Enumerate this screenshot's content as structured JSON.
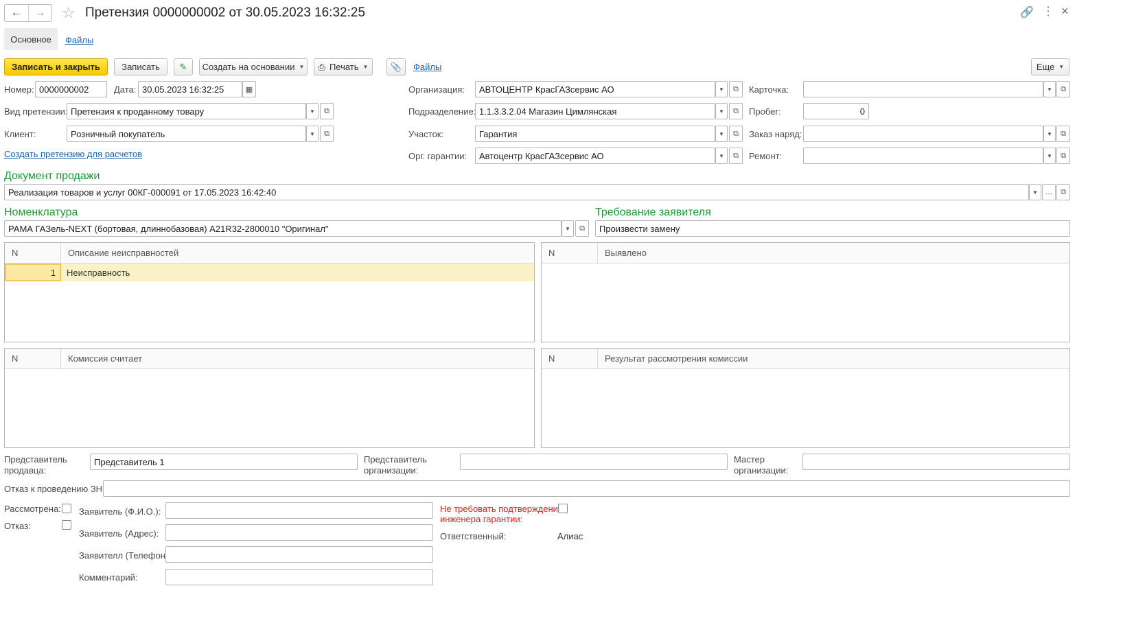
{
  "window": {
    "title": "Претензия 0000000002 от 30.05.2023 16:32:25",
    "back_icon": "arrow-left-icon",
    "forward_icon": "arrow-right-icon"
  },
  "tabs": {
    "main": "Основное",
    "files": "Файлы"
  },
  "toolbar": {
    "save_close": "Записать и закрыть",
    "save": "Записать",
    "create_based": "Создать на основании",
    "print": "Печать",
    "files_link": "Файлы",
    "more": "Еще"
  },
  "fields": {
    "number_label": "Номер:",
    "number": "0000000002",
    "date_label": "Дата:",
    "date": "30.05.2023 16:32:25",
    "claim_type_label": "Вид претензии:",
    "claim_type": "Претензия к проданному товару",
    "client_label": "Клиент:",
    "client": "Розничный покупатель",
    "create_claim_link": "Создать претензию для расчетов",
    "org_label": "Организация:",
    "org": "АВТОЦЕНТР КрасГАЗсервис АО",
    "dept_label": "Подразделение:",
    "dept": "1.1.3.3.2.04 Магазин Цимлянская",
    "area_label": "Участок:",
    "area": "Гарантия",
    "warranty_org_label": "Орг. гарантии:",
    "warranty_org": "Автоцентр КрасГАЗсервис АО",
    "card_label": "Карточка:",
    "card": "",
    "mileage_label": "Пробег:",
    "mileage": "0",
    "work_order_label": "Заказ наряд:",
    "work_order": "",
    "repair_label": "Ремонт:",
    "repair": ""
  },
  "sale_doc": {
    "heading": "Документ продажи",
    "value": "Реализация товаров и услуг 00КГ-000091 от 17.05.2023 16:42:40"
  },
  "nomenclature": {
    "heading": "Номенклатура",
    "value": "РАМА ГАЗель-NEXT (бортовая, длиннобазовая) А21R32-2800010 \"Оригинал\""
  },
  "requirement": {
    "heading": "Требование заявителя",
    "value": "Произвести замену"
  },
  "tables": {
    "faults": {
      "col_n": "N",
      "col_desc": "Описание неисправностей",
      "rows": [
        {
          "n": "1",
          "text": "Неисправность"
        }
      ]
    },
    "found": {
      "col_n": "N",
      "col_desc": "Выявлено"
    },
    "commission": {
      "col_n": "N",
      "col_desc": "Комиссия считает"
    },
    "result": {
      "col_n": "N",
      "col_desc": "Результат рассмотрения комиссии"
    }
  },
  "bottom": {
    "seller_rep_label_1": "Представитель",
    "seller_rep_label_2": "продавца:",
    "seller_rep": "Представитель 1",
    "org_rep_label_1": "Представитель",
    "org_rep_label_2": "организации:",
    "org_rep": "",
    "master_label_1": "Мастер",
    "master_label_2": "организации:",
    "master": "",
    "refusal_label": "Отказ к проведению ЗН:",
    "refusal": "",
    "reviewed_label": "Рассмотрена:",
    "refuse_label": "Отказ:",
    "applicant_name_label": "Заявитель (Ф.И.О.):",
    "applicant_address_label": "Заявитель (Адрес):",
    "applicant_phone_label": "Заявителл (Телефон):",
    "comment_label": "Комментарий:",
    "no_confirm_label_1": "Не требовать подтверждение",
    "no_confirm_label_2": "инженера гарантии:",
    "responsible_label": "Ответственный:",
    "responsible": "Алиас"
  }
}
